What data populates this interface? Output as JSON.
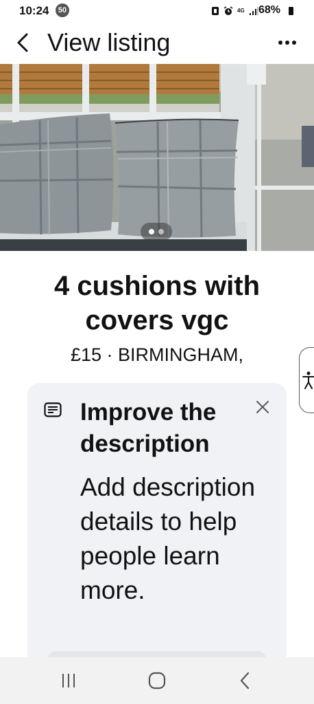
{
  "status_bar": {
    "time": "10:24",
    "notification_count": "50",
    "network": "4G",
    "battery": "68%"
  },
  "header": {
    "title": "View listing",
    "back_icon": "chevron-left-icon",
    "more_icon": "more-horizontal-icon"
  },
  "photo": {
    "alt": "Plaid grey cushions on window sill",
    "total_photos": 2,
    "current_photo": 1
  },
  "listing": {
    "title": "4 cushions with covers vgc",
    "meta": "£15 · BIRMINGHAM,"
  },
  "suggestion_card": {
    "icon": "description-icon",
    "title": "Improve the description",
    "body": "Add description details to help people learn more.",
    "close_icon": "close-icon"
  },
  "nav_bar": {
    "recent_icon": "recent-apps-icon",
    "home_icon": "home-icon",
    "back_icon": "back-icon"
  },
  "colors": {
    "card_background": "#f0f2f5",
    "nav_background": "#f2f2f2",
    "text": "#111111"
  }
}
